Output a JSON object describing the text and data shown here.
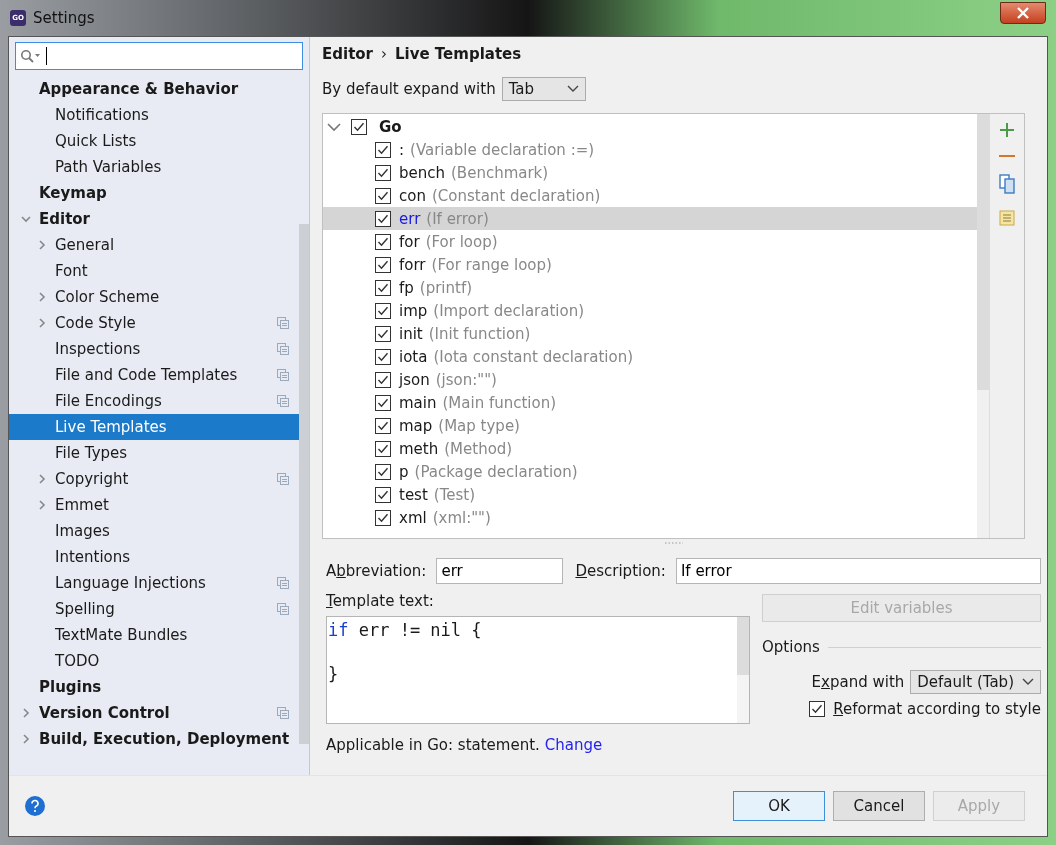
{
  "window": {
    "logo_text": "GO",
    "title": "Settings"
  },
  "sidebar": {
    "items": [
      {
        "label": "Appearance & Behavior",
        "selected": false,
        "shared": false,
        "children": [
          {
            "label": "Notifications",
            "selected": false,
            "shared": false
          },
          {
            "label": "Quick Lists",
            "selected": false,
            "shared": false
          },
          {
            "label": "Path Variables",
            "selected": false,
            "shared": false
          }
        ]
      },
      {
        "label": "Keymap",
        "selected": false,
        "shared": false
      },
      {
        "label": "Editor",
        "selected": false,
        "shared": false,
        "expanded": true,
        "children": [
          {
            "label": "General",
            "selected": false,
            "shared": false,
            "expanded": false
          },
          {
            "label": "Font",
            "selected": false,
            "shared": false
          },
          {
            "label": "Color Scheme",
            "selected": false,
            "shared": false,
            "expanded": false
          },
          {
            "label": "Code Style",
            "selected": false,
            "shared": true,
            "expanded": false
          },
          {
            "label": "Inspections",
            "selected": false,
            "shared": true
          },
          {
            "label": "File and Code Templates",
            "selected": false,
            "shared": true
          },
          {
            "label": "File Encodings",
            "selected": false,
            "shared": true
          },
          {
            "label": "Live Templates",
            "selected": true,
            "shared": false
          },
          {
            "label": "File Types",
            "selected": false,
            "shared": false
          },
          {
            "label": "Copyright",
            "selected": false,
            "shared": true,
            "expanded": false
          },
          {
            "label": "Emmet",
            "selected": false,
            "shared": false,
            "expanded": false
          },
          {
            "label": "Images",
            "selected": false,
            "shared": false
          },
          {
            "label": "Intentions",
            "selected": false,
            "shared": false
          },
          {
            "label": "Language Injections",
            "selected": false,
            "shared": true
          },
          {
            "label": "Spelling",
            "selected": false,
            "shared": true
          },
          {
            "label": "TextMate Bundles",
            "selected": false,
            "shared": false
          },
          {
            "label": "TODO",
            "selected": false,
            "shared": false
          }
        ]
      },
      {
        "label": "Plugins",
        "selected": false,
        "shared": false
      },
      {
        "label": "Version Control",
        "selected": false,
        "shared": true,
        "expanded": false
      },
      {
        "label": "Build, Execution, Deployment",
        "selected": false,
        "shared": false,
        "expanded": false
      }
    ]
  },
  "breadcrumb": [
    "Editor",
    "›",
    "Live Templates"
  ],
  "expand_default": {
    "label": "By default expand with",
    "value": "Tab"
  },
  "templates": {
    "group": {
      "name": "Go",
      "checked": true,
      "expanded": true
    },
    "items": [
      {
        "abbr": ":",
        "desc": "(Variable declaration :=)",
        "checked": true,
        "selected": false
      },
      {
        "abbr": "bench",
        "desc": "(Benchmark)",
        "checked": true,
        "selected": false
      },
      {
        "abbr": "con",
        "desc": "(Constant declaration)",
        "checked": true,
        "selected": false
      },
      {
        "abbr": "err",
        "desc": "(If error)",
        "checked": true,
        "selected": true
      },
      {
        "abbr": "for",
        "desc": "(For loop)",
        "checked": true,
        "selected": false
      },
      {
        "abbr": "forr",
        "desc": "(For range loop)",
        "checked": true,
        "selected": false
      },
      {
        "abbr": "fp",
        "desc": "(printf)",
        "checked": true,
        "selected": false
      },
      {
        "abbr": "imp",
        "desc": "(Import declaration)",
        "checked": true,
        "selected": false
      },
      {
        "abbr": "init",
        "desc": "(Init function)",
        "checked": true,
        "selected": false
      },
      {
        "abbr": "iota",
        "desc": "(Iota constant declaration)",
        "checked": true,
        "selected": false
      },
      {
        "abbr": "json",
        "desc": "(json:\"\")",
        "checked": true,
        "selected": false
      },
      {
        "abbr": "main",
        "desc": "(Main function)",
        "checked": true,
        "selected": false
      },
      {
        "abbr": "map",
        "desc": "(Map type)",
        "checked": true,
        "selected": false
      },
      {
        "abbr": "meth",
        "desc": "(Method)",
        "checked": true,
        "selected": false
      },
      {
        "abbr": "p",
        "desc": "(Package declaration)",
        "checked": true,
        "selected": false
      },
      {
        "abbr": "test",
        "desc": "(Test)",
        "checked": true,
        "selected": false
      },
      {
        "abbr": "xml",
        "desc": "(xml:\"\")",
        "checked": true,
        "selected": false
      }
    ]
  },
  "abbreviation": {
    "label_before": "A",
    "mnemonic": "b",
    "label_after": "breviation:",
    "value": "err"
  },
  "description": {
    "mnemonic": "D",
    "label_after": "escription:",
    "value": "If error"
  },
  "template_text": {
    "mnemonic": "T",
    "label_after": "emplate text:",
    "lines": [
      {
        "kind": "code",
        "keyword": "if",
        "text": "err != nil {"
      },
      {
        "kind": "blank"
      },
      {
        "kind": "code",
        "text": "}"
      }
    ]
  },
  "edit_variables": {
    "label": "Edit variables",
    "disabled": true
  },
  "options": {
    "title": "Options",
    "expand_with": {
      "label_before": "E",
      "mnemonic": "x",
      "label_after": "pand with",
      "value": "Default (Tab)"
    },
    "reformat": {
      "mnemonic": "R",
      "label_after": "eformat according to style",
      "checked": true
    }
  },
  "applicable": {
    "text": "Applicable in Go: statement.",
    "link": "Change"
  },
  "buttons": [
    {
      "label": "OK",
      "kind": "primary",
      "disabled": false
    },
    {
      "label": "Cancel",
      "kind": "normal",
      "disabled": false
    },
    {
      "label": "Apply",
      "kind": "normal",
      "disabled": true
    }
  ]
}
